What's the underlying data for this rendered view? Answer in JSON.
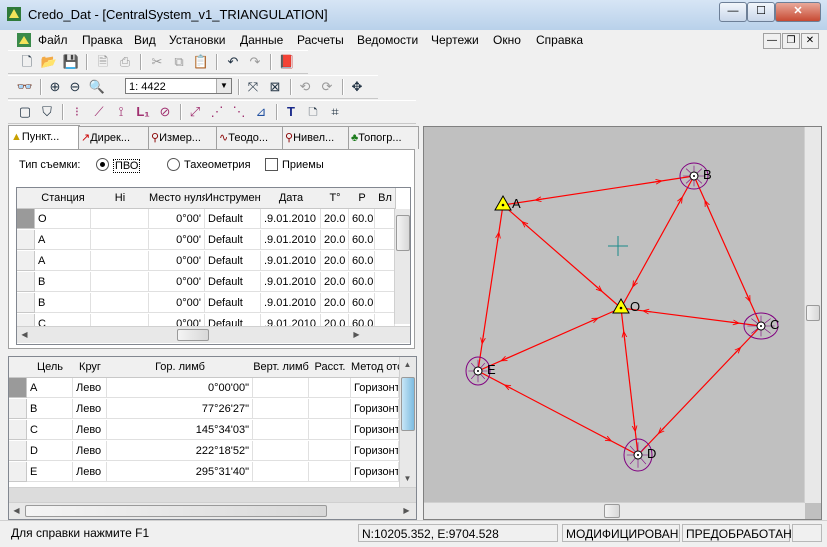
{
  "window": {
    "title": "Credo_Dat - [CentralSystem_v1_TRIANGULATION]",
    "min_glyph": "—",
    "max_glyph": "☐",
    "close_glyph": "✕"
  },
  "menu": [
    {
      "label": "Файл"
    },
    {
      "label": "Правка"
    },
    {
      "label": "Вид"
    },
    {
      "label": "Установки"
    },
    {
      "label": "Данные"
    },
    {
      "label": "Расчеты"
    },
    {
      "label": "Ведомости"
    },
    {
      "label": "Чертежи"
    },
    {
      "label": "Окно"
    },
    {
      "label": "Справка"
    }
  ],
  "mdi_buttons": {
    "min": "—",
    "restore": "❐",
    "close": "✕"
  },
  "toolbar2": {
    "scale": "1: 4422"
  },
  "tabs": [
    {
      "label": "Пункт..."
    },
    {
      "label": "Дирек..."
    },
    {
      "label": "Измер..."
    },
    {
      "label": "Теодо..."
    },
    {
      "label": "Нивел..."
    },
    {
      "label": "Топогр..."
    }
  ],
  "survey": {
    "label": "Тип съемки:",
    "opt1": "ПВО",
    "opt2": "Тахеометрия",
    "checkbox": "Приемы"
  },
  "stations_table": {
    "columns": [
      "Станция",
      "Hi",
      "Место нуля",
      "Инструмент",
      "Дата",
      "T°",
      "P",
      "Вл"
    ],
    "rows": [
      [
        "O",
        "",
        "0°00'",
        "Default",
        ".9.01.2010",
        "20.0",
        "60.0",
        ""
      ],
      [
        "A",
        "",
        "0°00'",
        "Default",
        ".9.01.2010",
        "20.0",
        "60.0",
        ""
      ],
      [
        "A",
        "",
        "0°00'",
        "Default",
        ".9.01.2010",
        "20.0",
        "60.0",
        ""
      ],
      [
        "B",
        "",
        "0°00'",
        "Default",
        ".9.01.2010",
        "20.0",
        "60.0",
        ""
      ],
      [
        "B",
        "",
        "0°00'",
        "Default",
        ".9.01.2010",
        "20.0",
        "60.0",
        ""
      ],
      [
        "C",
        "",
        "0°00'",
        "Default",
        ".9.01.2010",
        "20.0",
        "60.0",
        ""
      ]
    ]
  },
  "obs_table": {
    "columns": [
      "Цель",
      "Круг",
      "Гор. лимб",
      "Верт. лимб",
      "Расст.",
      "Метод отсчета"
    ],
    "rows": [
      [
        "A",
        "Лево",
        "0°00'00\"",
        "",
        "",
        "Горизонт"
      ],
      [
        "B",
        "Лево",
        "77°26'27\"",
        "",
        "",
        "Горизонт"
      ],
      [
        "C",
        "Лево",
        "145°34'03\"",
        "",
        "",
        "Горизонт"
      ],
      [
        "D",
        "Лево",
        "222°18'52\"",
        "",
        "",
        "Горизонт"
      ],
      [
        "E",
        "Лево",
        "295°31'40\"",
        "",
        "",
        "Горизонт"
      ]
    ]
  },
  "map": {
    "points": [
      {
        "name": "A"
      },
      {
        "name": "B"
      },
      {
        "name": "C"
      },
      {
        "name": "D"
      },
      {
        "name": "E"
      },
      {
        "name": "O"
      }
    ],
    "line_color": "#ff0000",
    "ellipse_color": "#800080",
    "marker_color": "#ffff00"
  },
  "status": {
    "help": "Для справки  нажмите  F1",
    "coords": "N:10205.352, E:9704.528",
    "modified": "МОДИФИЦИРОВАН",
    "preprocessed": "ПРЕДОБРАБОТАН"
  }
}
